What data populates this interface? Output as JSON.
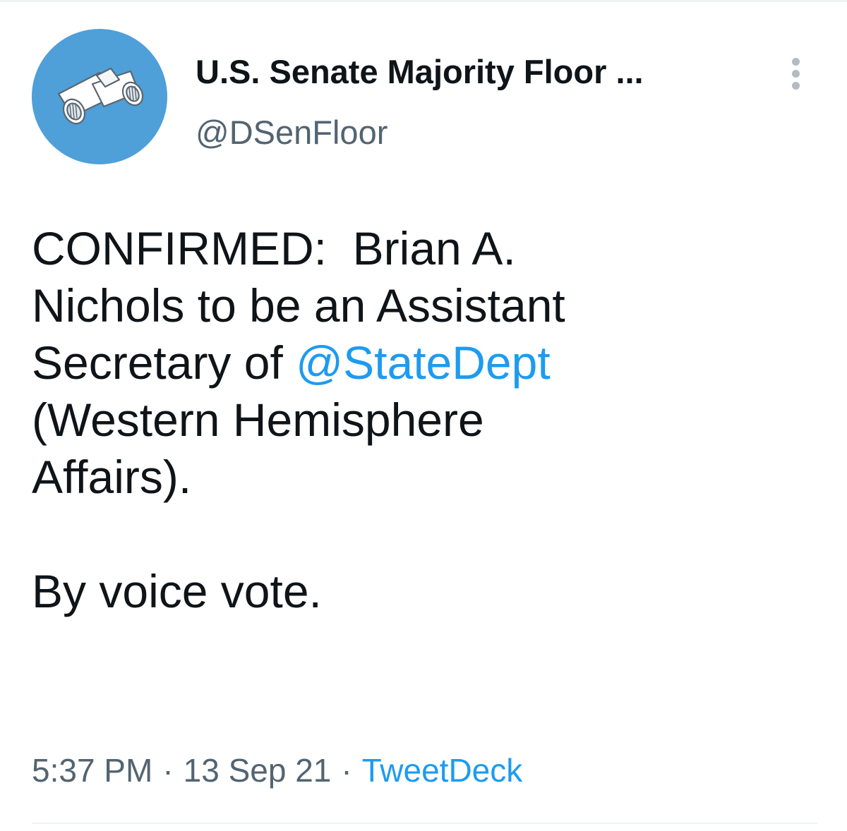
{
  "account": {
    "display_name": "U.S. Senate Majority Floor ...",
    "handle": "@DSenFloor",
    "avatar_icon": "binoculars-icon",
    "avatar_color": "#4f9fd8"
  },
  "menu": {
    "icon": "more-vertical-icon"
  },
  "tweet": {
    "lines": [
      {
        "before": "CONFIRMED:  Brian A.",
        "mention": "",
        "after": ""
      },
      {
        "before": "Nichols to be an Assistant",
        "mention": "",
        "after": ""
      },
      {
        "before": "Secretary of ",
        "mention": "@StateDept",
        "after": ""
      },
      {
        "before": "(Western Hemisphere",
        "mention": "",
        "after": ""
      },
      {
        "before": "Affairs).",
        "mention": "",
        "after": ""
      }
    ],
    "closing": "By voice vote."
  },
  "meta": {
    "time": "5:37 PM",
    "separator": "·",
    "date": "13 Sep 21",
    "source": "TweetDeck"
  },
  "colors": {
    "link": "#1d9bf0",
    "text": "#0f1419",
    "secondary": "#536471"
  }
}
